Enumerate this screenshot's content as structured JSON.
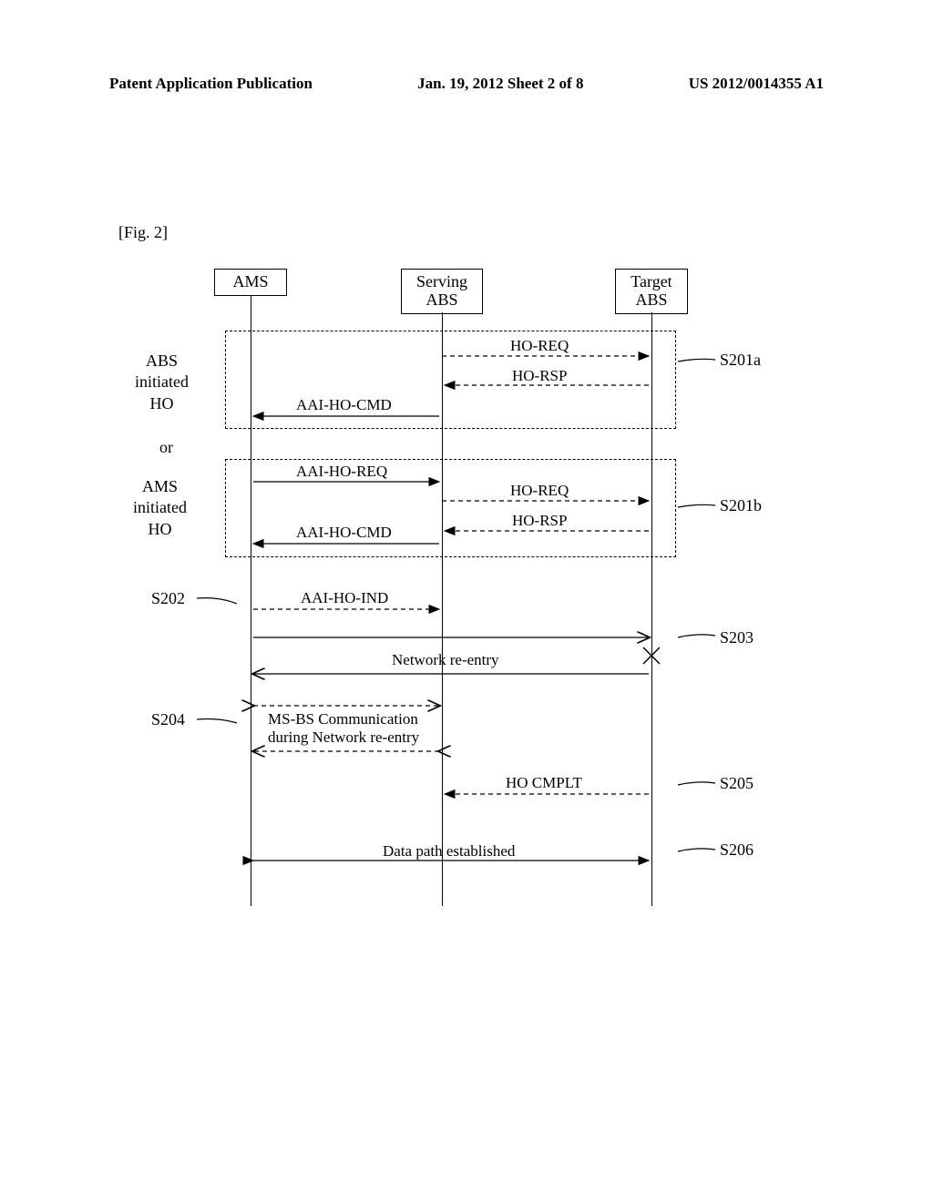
{
  "header": {
    "left": "Patent Application Publication",
    "center": "Jan. 19, 2012  Sheet 2 of 8",
    "right": "US 2012/0014355 A1"
  },
  "figLabel": "[Fig. 2]",
  "nodes": {
    "ams": "AMS",
    "serving": "Serving\nABS",
    "target": "Target\nABS"
  },
  "sideLabels": {
    "absInitiated": "ABS\ninitiated\nHO",
    "or": "or",
    "amsInitiated": "AMS\ninitiated\nHO"
  },
  "callouts": {
    "s201a": "S201a",
    "s201b": "S201b",
    "s202": "S202",
    "s203": "S203",
    "s204": "S204",
    "s205": "S205",
    "s206": "S206"
  },
  "messages": {
    "hoReq1": "HO-REQ",
    "hoRsp1": "HO-RSP",
    "aaiHoCmd1": "AAI-HO-CMD",
    "aaiHoReq": "AAI-HO-REQ",
    "hoReq2": "HO-REQ",
    "hoRsp2": "HO-RSP",
    "aaiHoCmd2": "AAI-HO-CMD",
    "aaiHoInd": "AAI-HO-IND",
    "netReentry": "Network re-entry",
    "msBs1": "MS-BS Communication",
    "msBs2": "during Network re-entry",
    "hoCmplt": "HO CMPLT",
    "dataPath": "Data path established"
  }
}
